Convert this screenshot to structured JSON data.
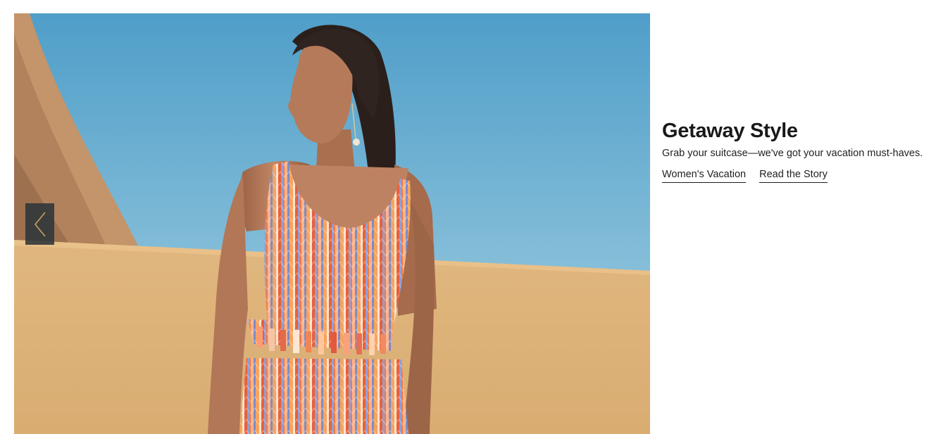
{
  "hero": {
    "colors": {
      "sky_top": "#4f9ec9",
      "sky_bottom": "#a9d3e3",
      "sand": "#ddb47c",
      "rock": "#c4946a"
    }
  },
  "carousel": {
    "prev_icon": "chevron-left-icon",
    "prev_color": "#c9a15c"
  },
  "promo": {
    "title": "Getaway Style",
    "subtitle": "Grab your suitcase—we've got your vacation must-haves.",
    "links": [
      {
        "label": "Women's Vacation"
      },
      {
        "label": "Read the Story"
      }
    ]
  }
}
